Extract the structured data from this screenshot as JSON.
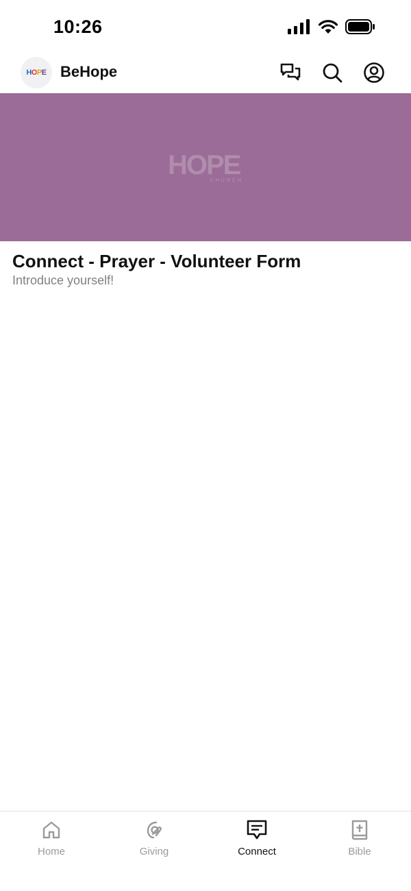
{
  "status_bar": {
    "time": "10:26"
  },
  "header": {
    "logo_text": "HOPE",
    "app_name": "BeHope"
  },
  "hero": {
    "logo_word": "HOPE",
    "logo_sub": "CHURCH",
    "background_color": "#9a6c97"
  },
  "content": {
    "title": "Connect - Prayer - Volunteer Form",
    "subtitle": "Introduce yourself!"
  },
  "tab_bar": {
    "tabs": [
      {
        "label": "Home",
        "icon": "home-icon",
        "active": false
      },
      {
        "label": "Giving",
        "icon": "giving-icon",
        "active": false
      },
      {
        "label": "Connect",
        "icon": "connect-icon",
        "active": true
      },
      {
        "label": "Bible",
        "icon": "bible-icon",
        "active": false
      }
    ]
  }
}
